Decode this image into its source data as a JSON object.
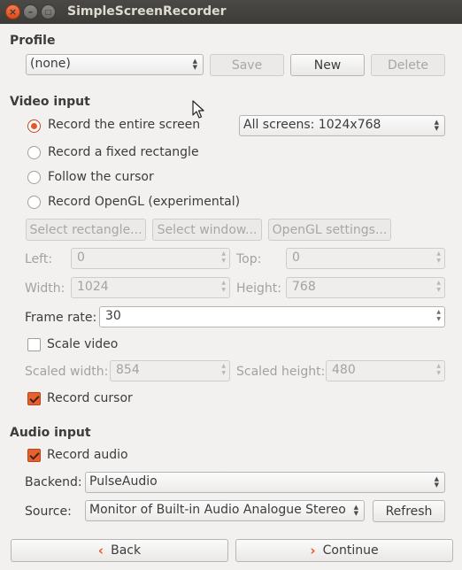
{
  "window": {
    "title": "SimpleScreenRecorder"
  },
  "profile": {
    "title": "Profile",
    "selected": "(none)",
    "save_label": "Save",
    "new_label": "New",
    "delete_label": "Delete"
  },
  "video": {
    "title": "Video input",
    "radio_entire": "Record the entire screen",
    "radio_rect": "Record a fixed rectangle",
    "radio_cursor": "Follow the cursor",
    "radio_opengl": "Record OpenGL (experimental)",
    "screen_select": "All screens: 1024x768",
    "select_rect_label": "Select rectangle...",
    "select_window_label": "Select window...",
    "opengl_settings_label": "OpenGL settings...",
    "left_label": "Left:",
    "left_value": "0",
    "top_label": "Top:",
    "top_value": "0",
    "width_label": "Width:",
    "width_value": "1024",
    "height_label": "Height:",
    "height_value": "768",
    "framerate_label": "Frame rate:",
    "framerate_value": "30",
    "scale_label": "Scale video",
    "scaled_width_label": "Scaled width:",
    "scaled_width_value": "854",
    "scaled_height_label": "Scaled height:",
    "scaled_height_value": "480",
    "record_cursor_label": "Record cursor"
  },
  "audio": {
    "title": "Audio input",
    "record_audio_label": "Record audio",
    "backend_label": "Backend:",
    "backend_value": "PulseAudio",
    "source_label": "Source:",
    "source_value": "Monitor of Built-in Audio Analogue Stereo",
    "refresh_label": "Refresh"
  },
  "footer": {
    "back_label": "Back",
    "continue_label": "Continue"
  },
  "icons": {
    "back": "chevron-left-icon",
    "continue": "chevron-right-icon"
  },
  "colors": {
    "accent": "#e15a27",
    "titlebar": "#3c3b37",
    "background": "#f2f1f0"
  }
}
